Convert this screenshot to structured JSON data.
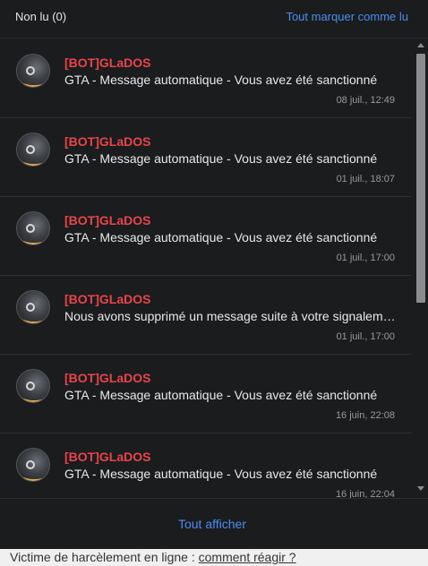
{
  "header": {
    "unread_label": "Non lu (0)",
    "mark_all_label": "Tout marquer comme lu"
  },
  "notifications": [
    {
      "author": "[BOT]GLaDOS",
      "message": "GTA - Message automatique - Vous avez été sanctionné",
      "date": "08 juil., 12:49"
    },
    {
      "author": "[BOT]GLaDOS",
      "message": "GTA - Message automatique - Vous avez été sanctionné",
      "date": "01 juil., 18:07"
    },
    {
      "author": "[BOT]GLaDOS",
      "message": "GTA - Message automatique - Vous avez été sanctionné",
      "date": "01 juil., 17:00"
    },
    {
      "author": "[BOT]GLaDOS",
      "message": "Nous avons supprimé un message suite à votre signalement",
      "date": "01 juil., 17:00"
    },
    {
      "author": "[BOT]GLaDOS",
      "message": "GTA - Message automatique - Vous avez été sanctionné",
      "date": "16 juin, 22:08"
    },
    {
      "author": "[BOT]GLaDOS",
      "message": "GTA - Message automatique - Vous avez été sanctionné",
      "date": "16 juin, 22:04"
    }
  ],
  "footer": {
    "show_all_label": "Tout afficher"
  },
  "bottom_bar": {
    "text": "Victime de harcèlement en ligne : ",
    "link_label": "comment réagir ?"
  },
  "colors": {
    "background": "#1b1c1e",
    "author": "#e8454a",
    "link": "#4a8ef0"
  }
}
